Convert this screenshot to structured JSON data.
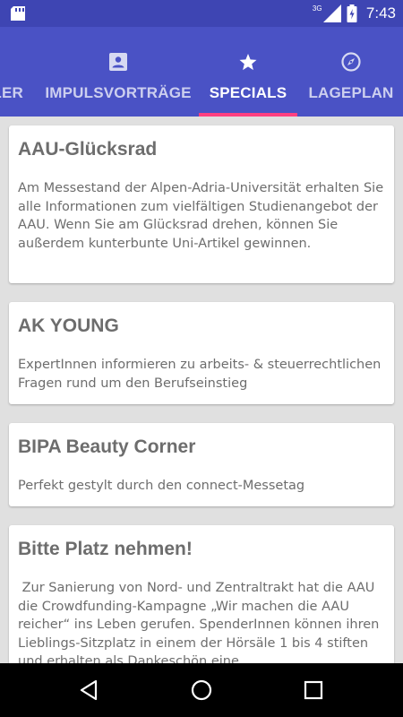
{
  "status_bar": {
    "network": "3G",
    "time": "7:43",
    "icons": [
      "sd-card-icon",
      "signal-icon",
      "battery-icon"
    ]
  },
  "tabs": [
    {
      "label": "LER",
      "icon": "partial-tab",
      "active": false
    },
    {
      "label": "IMPULSVORTRÄGE",
      "icon": "contact-card-icon",
      "active": false
    },
    {
      "label": "SPECIALS",
      "icon": "star-icon",
      "active": true
    },
    {
      "label": "LAGEPLAN",
      "icon": "compass-icon",
      "active": false
    }
  ],
  "cards": [
    {
      "title": "AAU-Glücksrad",
      "body": "Am Messestand der Alpen-Adria-Universität erhalten Sie alle Informationen zum vielfältigen Studienangebot der AAU. Wenn Sie am Glücksrad drehen, können Sie außerdem kunterbunte Uni-Artikel gewinnen."
    },
    {
      "title": "AK YOUNG",
      "body": "ExpertInnen informieren zu arbeits- & steuerrechtlichen Fragen rund um den Berufseinstieg"
    },
    {
      "title": "BIPA Beauty Corner",
      "body": "Perfekt gestylt durch den connect-Messetag"
    },
    {
      "title": "Bitte Platz nehmen!",
      "body": " Zur Sanierung von Nord- und Zentraltrakt hat die AAU die Crowdfunding-Kampagne „Wir machen die AAU reicher“ ins Leben gerufen. SpenderInnen können ihren Lieblings-Sitzplatz in einem der Hörsäle 1 bis 4 stiften und erhalten als Dankeschön eine"
    }
  ],
  "colors": {
    "status_bar": "#3e45b3",
    "app_bar": "#4a52c5",
    "indicator": "#ff4081",
    "background": "#e0e0e0",
    "card_text": "#6d6d6d"
  },
  "nav_bar": {
    "buttons": [
      "back-icon",
      "home-icon",
      "recents-icon"
    ]
  }
}
